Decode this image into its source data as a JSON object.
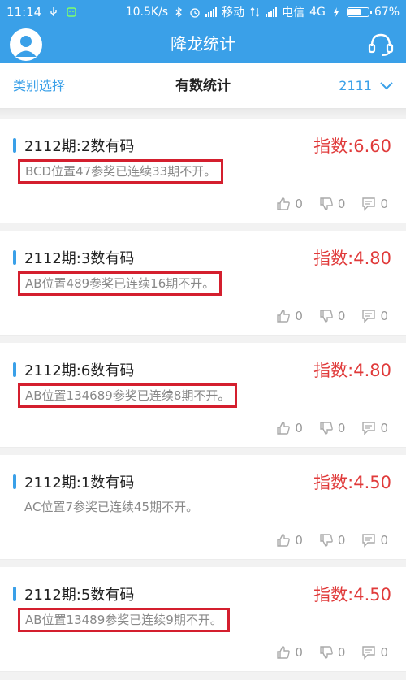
{
  "status_bar": {
    "time": "11:14",
    "speed": "10.5K/s",
    "carrier1": "移动",
    "carrier2": "电信",
    "network": "4G",
    "battery": "67%",
    "battery_level": 0.67
  },
  "app_bar": {
    "title": "降龙统计"
  },
  "tab_bar": {
    "left_label": "类别选择",
    "center_label": "有数统计",
    "period_select": "2111"
  },
  "items": [
    {
      "period": "2112期:2数有码",
      "index": "指数:6.60",
      "desc": "BCD位置47参奖已连续33期不开。",
      "boxed": true,
      "likes": "0",
      "dislikes": "0",
      "comments": "0"
    },
    {
      "period": "2112期:3数有码",
      "index": "指数:4.80",
      "desc": "AB位置489参奖已连续16期不开。",
      "boxed": true,
      "likes": "0",
      "dislikes": "0",
      "comments": "0"
    },
    {
      "period": "2112期:6数有码",
      "index": "指数:4.80",
      "desc": "AB位置134689参奖已连续8期不开。",
      "boxed": true,
      "likes": "0",
      "dislikes": "0",
      "comments": "0"
    },
    {
      "period": "2112期:1数有码",
      "index": "指数:4.50",
      "desc": "AC位置7参奖已连续45期不开。",
      "boxed": false,
      "likes": "0",
      "dislikes": "0",
      "comments": "0"
    },
    {
      "period": "2112期:5数有码",
      "index": "指数:4.50",
      "desc": "AB位置13489参奖已连续9期不开。",
      "boxed": true,
      "likes": "0",
      "dislikes": "0",
      "comments": "0"
    }
  ],
  "icons": {
    "like": "thumbs-up-icon",
    "dislike": "thumbs-down-icon",
    "comment": "comment-icon",
    "avatar": "user-avatar-icon",
    "headset": "headset-icon",
    "dropdown": "chevron-down-icon"
  },
  "colors": {
    "primary": "#3aa0e8",
    "index_red": "#e03a3a",
    "highlight_box": "#d41f2e"
  }
}
